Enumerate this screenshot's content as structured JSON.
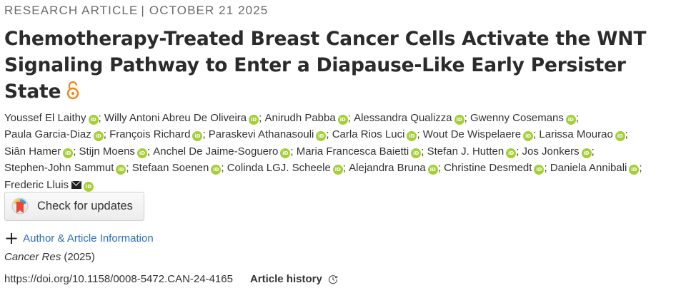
{
  "header": {
    "article_type": "RESEARCH ARTICLE",
    "separator": "|",
    "date": "OCTOBER 21 2025"
  },
  "title": "Chemotherapy-Treated Breast Cancer Cells Activate the WNT Signaling Pathway to Enter a Diapause-Like Early Persister State",
  "open_access_icon": "open-lock-icon",
  "authors": [
    {
      "name": "Youssef El Laithy",
      "orcid": true
    },
    {
      "name": "Willy Antoni Abreu De Oliveira",
      "orcid": true
    },
    {
      "name": "Anirudh Pabba",
      "orcid": true
    },
    {
      "name": "Alessandra Qualizza",
      "orcid": true
    },
    {
      "name": "Gwenny Cosemans",
      "orcid": true
    },
    {
      "name": "Paula Garcia-Diaz",
      "orcid": true
    },
    {
      "name": "François Richard",
      "orcid": true
    },
    {
      "name": "Paraskevi Athanasouli",
      "orcid": true
    },
    {
      "name": "Carla Rios Luci",
      "orcid": true
    },
    {
      "name": "Wout De Wispelaere",
      "orcid": true
    },
    {
      "name": "Larissa Mourao",
      "orcid": true
    },
    {
      "name": "Siân Hamer",
      "orcid": true
    },
    {
      "name": "Stijn Moens",
      "orcid": true
    },
    {
      "name": "Anchel De Jaime-Soguero",
      "orcid": true
    },
    {
      "name": "Maria Francesca Baietti",
      "orcid": true
    },
    {
      "name": "Stefan J. Hutten",
      "orcid": true
    },
    {
      "name": "Jos Jonkers",
      "orcid": true
    },
    {
      "name": "Stephen-John Sammut",
      "orcid": true
    },
    {
      "name": "Stefaan Soenen",
      "orcid": true
    },
    {
      "name": "Colinda LGJ. Scheele",
      "orcid": true
    },
    {
      "name": "Alejandra Bruna",
      "orcid": true
    },
    {
      "name": "Christine Desmedt",
      "orcid": true
    },
    {
      "name": "Daniela Annibali",
      "orcid": true
    },
    {
      "name": "Frederic Lluis",
      "orcid": true,
      "email": true
    }
  ],
  "orcid_badge_text": "iD",
  "check_updates": {
    "label": "Check for updates",
    "icon": "crossmark-icon"
  },
  "author_info": {
    "label": "Author & Article Information",
    "icon": "plus-icon"
  },
  "journal": {
    "name": "Cancer Res",
    "year": "(2025)"
  },
  "doi": "https://doi.org/10.1158/0008-5472.CAN-24-4165",
  "article_history": {
    "label": "Article history",
    "icon": "clock-icon"
  },
  "colors": {
    "link": "#2a6ebb",
    "orcid": "#a6ce39",
    "open_access": "#f68212"
  }
}
